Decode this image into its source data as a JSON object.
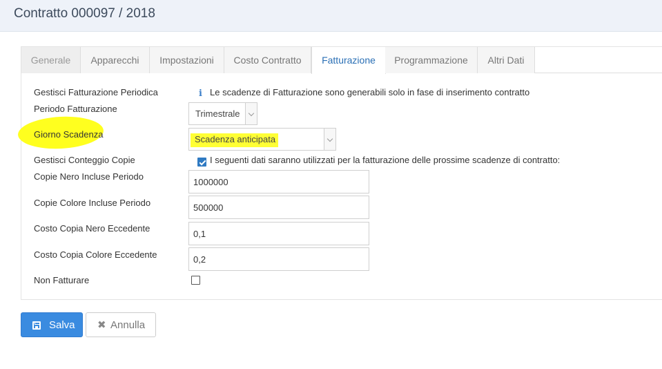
{
  "header": {
    "title": "Contratto 000097 / 2018"
  },
  "tabs": [
    {
      "label": "Generale"
    },
    {
      "label": "Apparecchi"
    },
    {
      "label": "Impostazioni"
    },
    {
      "label": "Costo Contratto"
    },
    {
      "label": "Fatturazione"
    },
    {
      "label": "Programmazione"
    },
    {
      "label": "Altri Dati"
    }
  ],
  "active_tab": "Fatturazione",
  "form": {
    "gestisci_fatturazione": {
      "label": "Gestisci Fatturazione Periodica",
      "info": "Le scadenze di Fatturazione sono generabili solo in fase di inserimento contratto",
      "icon": "info-icon"
    },
    "periodo_fatturazione": {
      "label": "Periodo Fatturazione",
      "value": "Trimestrale"
    },
    "giorno_scadenza": {
      "label": "Giorno Scadenza",
      "value": "Scadenza anticipata"
    },
    "gestisci_conteggio": {
      "label": "Gestisci Conteggio Copie",
      "checked": true,
      "text": "I seguenti dati saranno utilizzati per la fatturazione delle prossime scadenze di contratto:"
    },
    "copie_nero": {
      "label": "Copie Nero Incluse Periodo",
      "value": "1000000"
    },
    "copie_colore": {
      "label": "Copie Colore Incluse Periodo",
      "value": "500000"
    },
    "costo_nero": {
      "label": "Costo Copia Nero Eccedente",
      "value": "0,1"
    },
    "costo_colore": {
      "label": "Costo Copia Colore Eccedente",
      "value": "0,2"
    },
    "non_fatturare": {
      "label": "Non Fatturare",
      "checked": false
    }
  },
  "buttons": {
    "save": "Salva",
    "cancel": "Annulla"
  },
  "colors": {
    "accent": "#3a8be0",
    "active_tab": "#2a6fb5",
    "highlight": "#ffff1f"
  }
}
